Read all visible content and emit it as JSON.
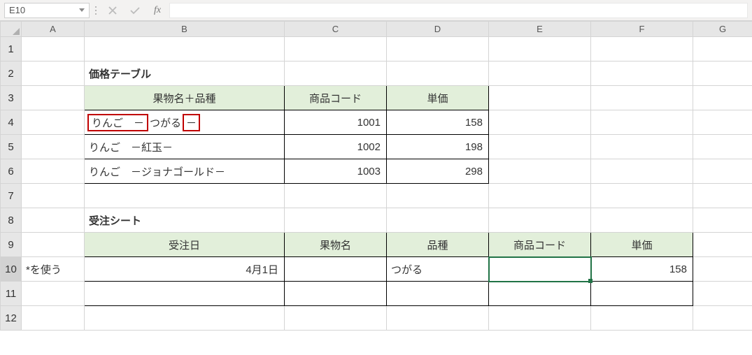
{
  "formula_bar": {
    "name_box": "E10",
    "fx_label": "fx",
    "formula": ""
  },
  "columns": [
    "A",
    "B",
    "C",
    "D",
    "E",
    "F",
    "G"
  ],
  "rows": [
    "1",
    "2",
    "3",
    "4",
    "5",
    "6",
    "7",
    "8",
    "9",
    "10",
    "11",
    "12"
  ],
  "titles": {
    "price_table": "価格テーブル",
    "order_sheet": "受注シート"
  },
  "price_headers": {
    "name": "果物名＋品種",
    "code": "商品コード",
    "price": "単価"
  },
  "price_rows": [
    {
      "name_part1": "りんご　－",
      "name_mid": "つがる",
      "name_part2": "－",
      "code": "1001",
      "price": "158"
    },
    {
      "name": "りんご　－紅玉－",
      "code": "1002",
      "price": "198"
    },
    {
      "name": "りんご　－ジョナゴールド－",
      "code": "1003",
      "price": "298"
    }
  ],
  "order_headers": {
    "date": "受注日",
    "fruit": "果物名",
    "variety": "品種",
    "code": "商品コード",
    "price": "単価"
  },
  "order_row": {
    "note": "*を使う",
    "date": "4月1日",
    "fruit": "",
    "variety": "つがる",
    "code": "",
    "price": "158"
  }
}
